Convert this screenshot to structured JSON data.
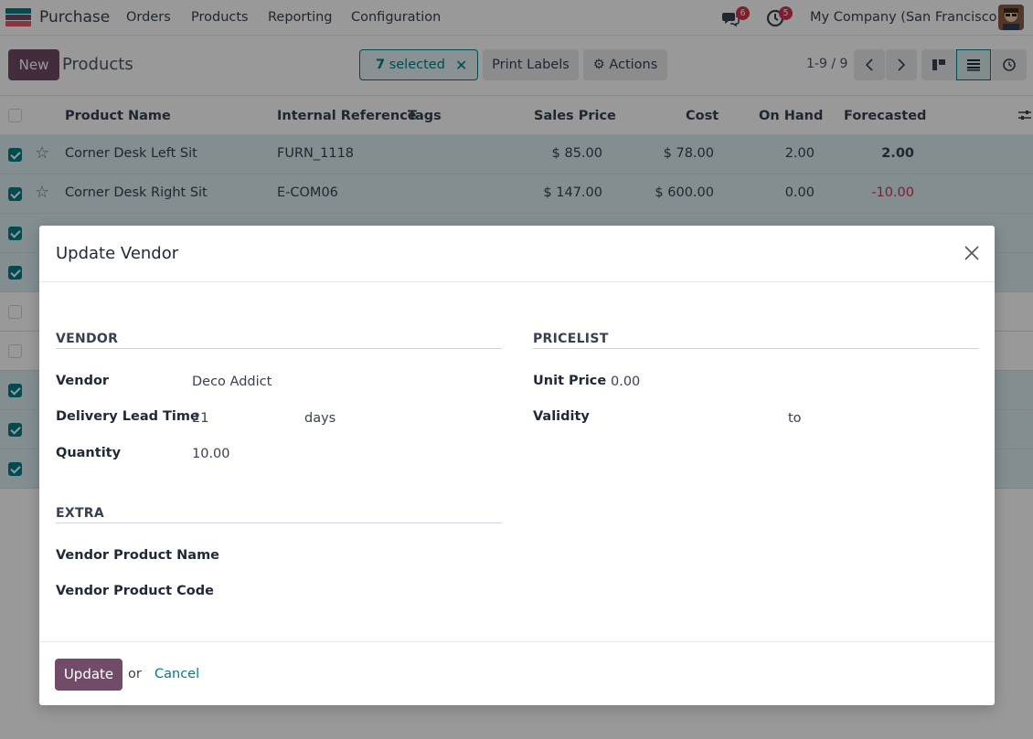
{
  "navbar": {
    "app_name": "Purchase",
    "menu": [
      "Orders",
      "Products",
      "Reporting",
      "Configuration"
    ],
    "messages_badge": "6",
    "activities_badge": "5",
    "company": "My Company (San Francisco)"
  },
  "control_panel": {
    "new_label": "New",
    "title": "Products",
    "selected_count": "7",
    "selected_label": "selected",
    "print_labels": "Print Labels",
    "actions": "Actions",
    "pager": "1-9 / 9"
  },
  "list": {
    "columns": [
      "Product Name",
      "Internal Reference",
      "Tags",
      "Sales Price",
      "Cost",
      "On Hand",
      "Forecasted"
    ],
    "rows": [
      {
        "name": "Corner Desk Left Sit",
        "ref": "FURN_1118",
        "price": "$ 85.00",
        "cost": "$ 78.00",
        "on_hand": "2.00",
        "forecast": "2.00",
        "selected": true
      },
      {
        "name": "Corner Desk Right Sit",
        "ref": "E-COM06",
        "price": "$ 147.00",
        "cost": "$ 600.00",
        "on_hand": "0.00",
        "forecast": "-10.00",
        "selected": true
      }
    ]
  },
  "dialog": {
    "title": "Update Vendor",
    "vendor_section": "VENDOR",
    "pricelist_section": "PRICELIST",
    "extra_section": "EXTRA",
    "vendor_label": "Vendor",
    "vendor_value": "Deco Addict",
    "lead_label": "Delivery Lead Time",
    "lead_value": "21",
    "lead_unit": "days",
    "quantity_label": "Quantity",
    "quantity_value": "10.00",
    "unit_price_label": "Unit Price",
    "unit_price_value": "0.00",
    "validity_label": "Validity",
    "validity_to": "to",
    "vendor_product_name_label": "Vendor Product Name",
    "vendor_product_code_label": "Vendor Product Code",
    "update_label": "Update",
    "or_text": "or",
    "cancel_label": "Cancel"
  },
  "colors": {
    "brand": "#714b67",
    "accent": "#017e84",
    "negative": "#d9304f"
  }
}
